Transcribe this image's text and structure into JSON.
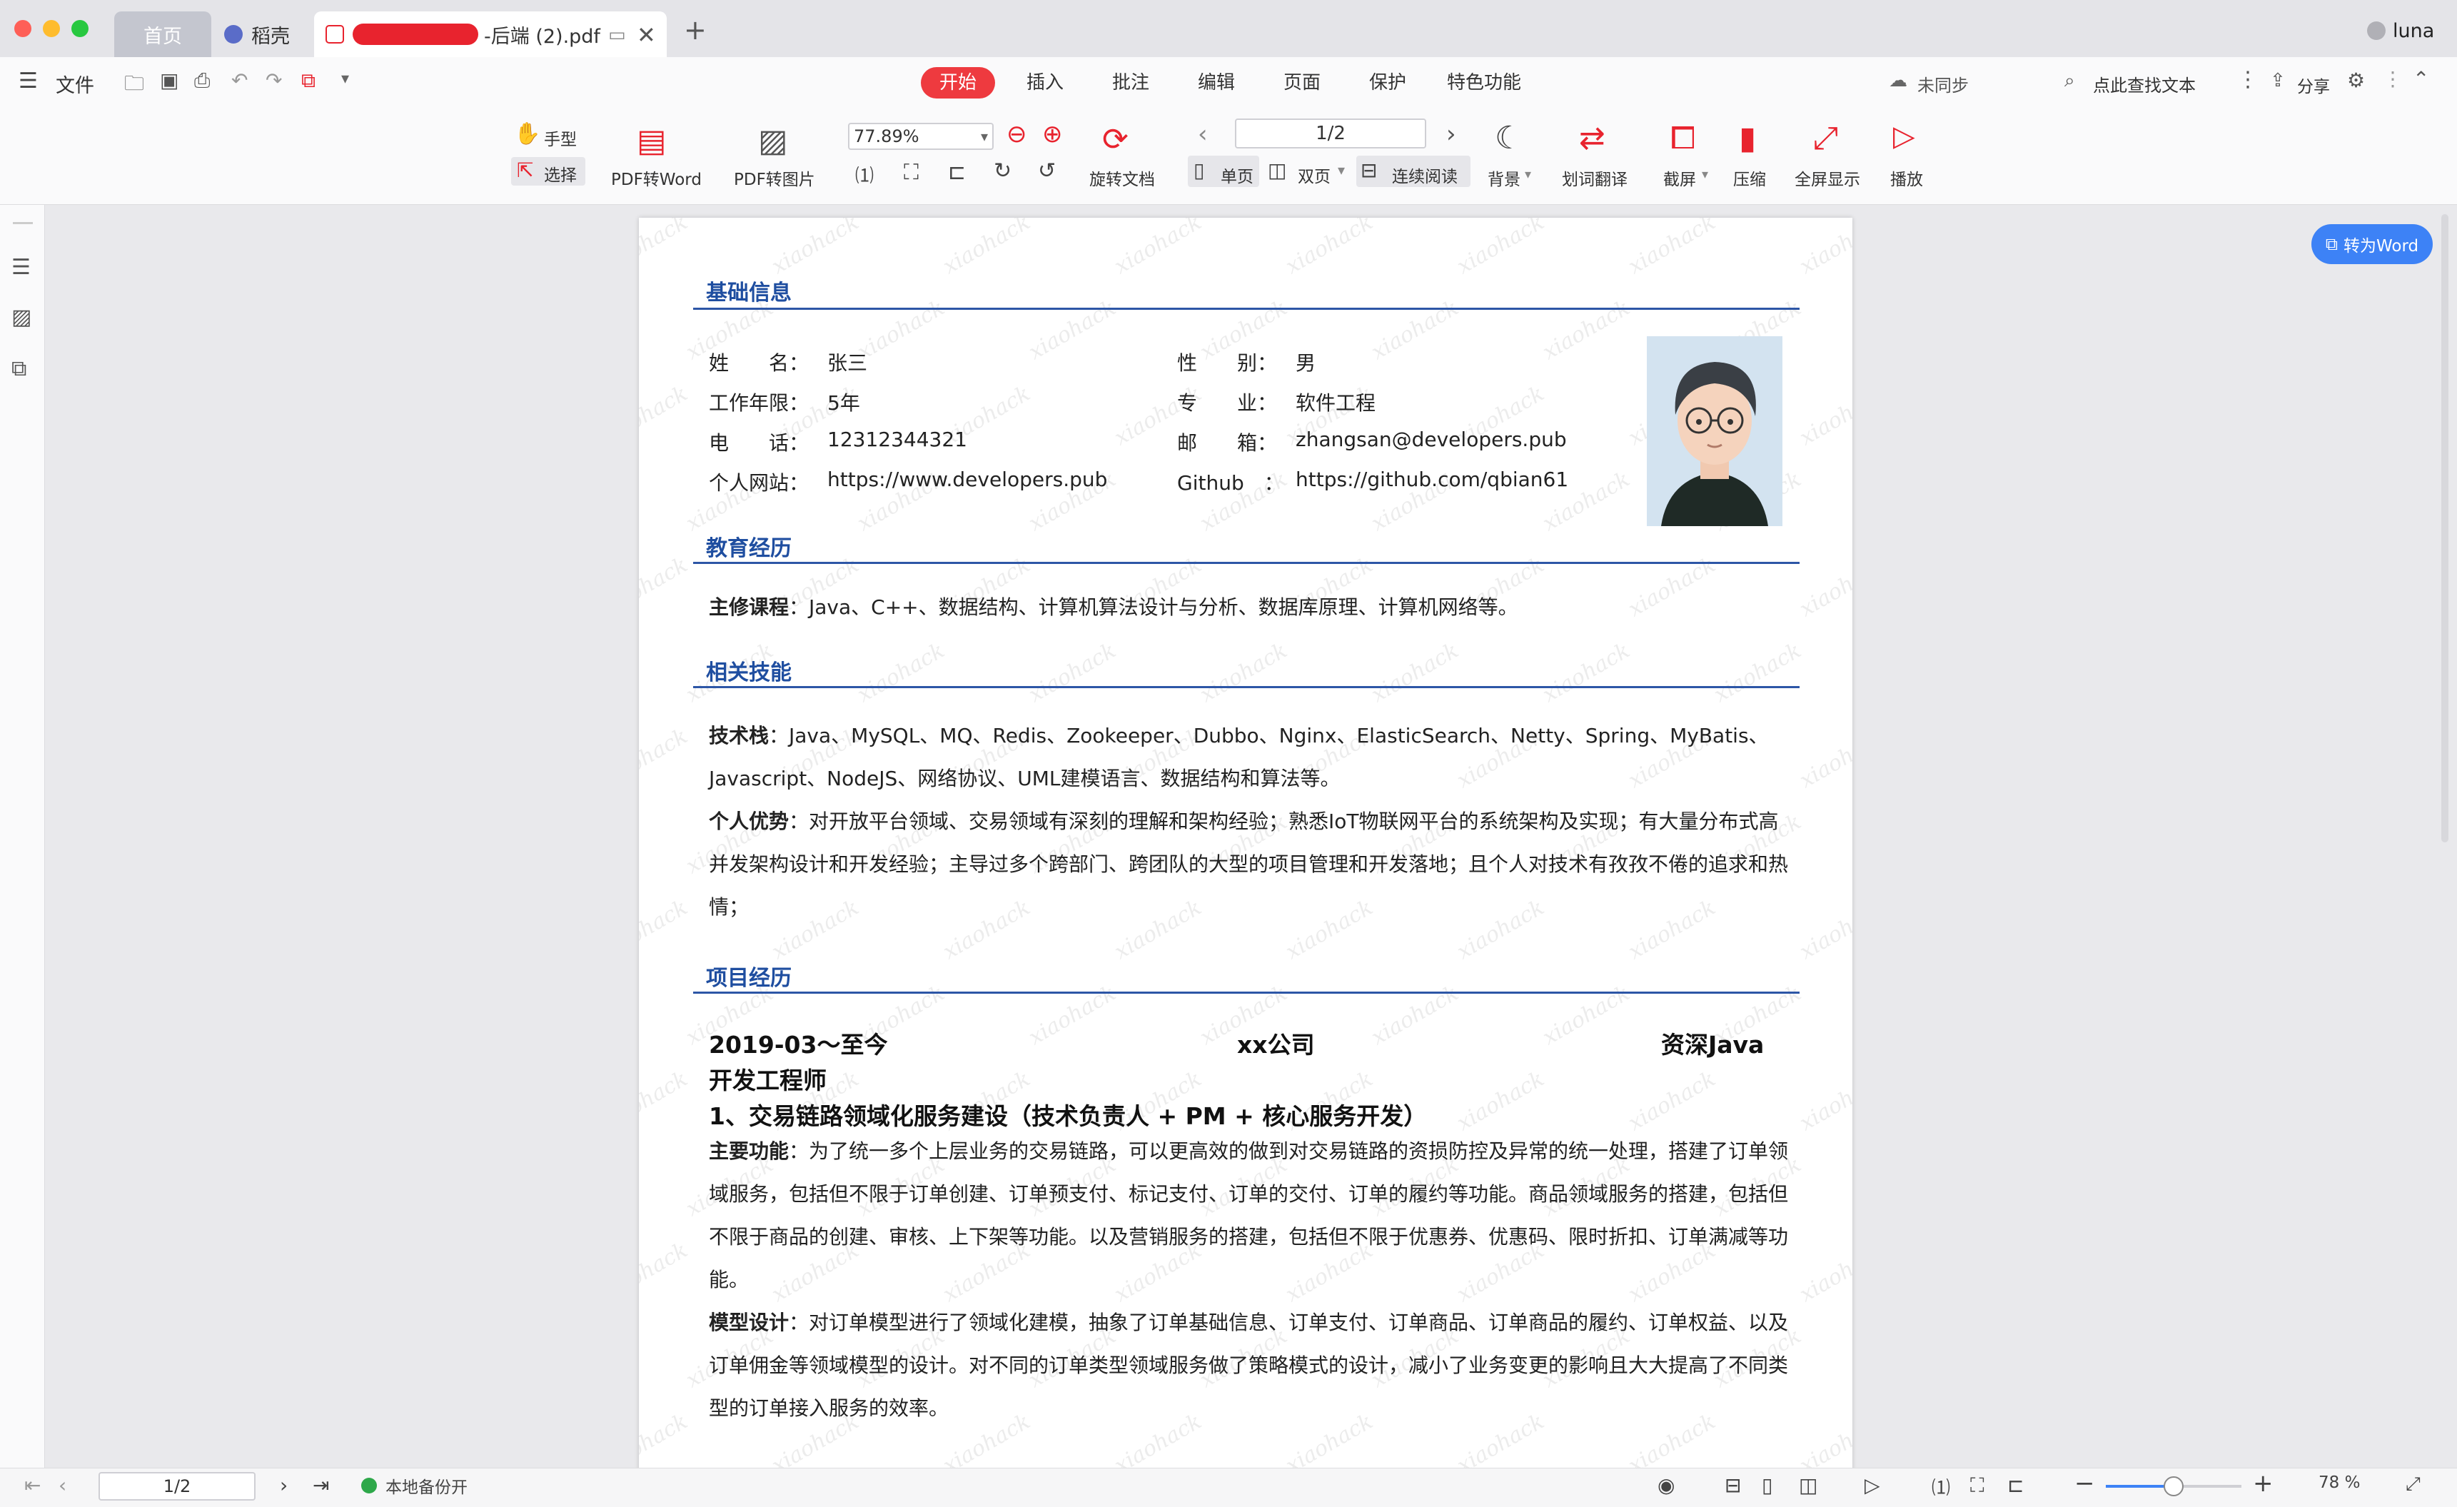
{
  "titlebar": {
    "tabs": [
      {
        "label": "首页"
      },
      {
        "label": "稻壳"
      },
      {
        "label": "-后端 (2).pdf"
      }
    ],
    "user": "luna"
  },
  "ribbon": {
    "file": "文件",
    "tabs": [
      "开始",
      "插入",
      "批注",
      "编辑",
      "页面",
      "保护",
      "特色功能"
    ],
    "sync": "未同步",
    "search": "点此查找文本",
    "share": "分享",
    "tools": {
      "hand": "手型",
      "select": "选择",
      "pdf_to_word": "PDF转Word",
      "pdf_to_image": "PDF转图片",
      "zoom": "77.89%",
      "page": "1/2",
      "rotate": "旋转文档",
      "single": "单页",
      "double": "双页",
      "continuous": "连续阅读",
      "background": "背景",
      "translate": "划词翻译",
      "screenshot": "截屏",
      "compress": "压缩",
      "fullscreen": "全屏显示",
      "play": "播放"
    },
    "convert_button": "转为Word"
  },
  "resume": {
    "watermark": "xiaohack",
    "sections": {
      "basic": "基础信息",
      "education": "教育经历",
      "skills": "相关技能",
      "projects": "项目经历"
    },
    "basic": {
      "name_label": "姓　　名：",
      "name": "张三",
      "years_label": "工作年限：",
      "years": "5年",
      "phone_label": "电　　话：",
      "phone": "12312344321",
      "site_label": "个人网站：",
      "site": "https://www.developers.pub",
      "gender_label": "性　　别：",
      "gender": "男",
      "major_label": "专　　业：",
      "major": "软件工程",
      "email_label": "邮　　箱：",
      "email": "zhangsan@developers.pub",
      "github_label": "Github　：",
      "github": "https://github.com/qbian61"
    },
    "education": {
      "label": "主修课程",
      "text": "：Java、C++、数据结构、计算机算法设计与分析、数据库原理、计算机网络等。"
    },
    "skills": {
      "stack_label": "技术栈",
      "stack": "：Java、MySQL、MQ、Redis、Zookeeper、Dubbo、Nginx、ElasticSearch、Netty、Spring、MyBatis、Javascript、NodeJS、网络协议、UML建模语言、数据结构和算法等。",
      "adv_label": "个人优势",
      "adv": "：对开放平台领域、交易领域有深刻的理解和架构经验；熟悉IoT物联网平台的系统架构及实现；有大量分布式高并发架构设计和开发经验；主导过多个跨部门、跨团队的大型的项目管理和开发落地；且个人对技术有孜孜不倦的追求和热情；"
    },
    "project": {
      "period": "2019-03～至今",
      "company": "xx公司",
      "role_a": "资深Java",
      "role_b": "开发工程师",
      "title": "1、交易链路领域化服务建设（技术负责人 + PM + 核心服务开发）",
      "func_label": "主要功能",
      "func": "：为了统一多个上层业务的交易链路，可以更高效的做到对交易链路的资损防控及异常的统一处理，搭建了订单领域服务，包括但不限于订单创建、订单预支付、标记支付、订单的交付、订单的履约等功能。商品领域服务的搭建，包括但不限于商品的创建、审核、上下架等功能。以及营销服务的搭建，包括但不限于优惠券、优惠码、限时折扣、订单满减等功能。",
      "model_label": "模型设计",
      "model": "：对订单模型进行了领域化建模，抽象了订单基础信息、订单支付、订单商品、订单商品的履约、订单权益、以及订单佣金等领域模型的设计。对不同的订单类型领域服务做了策略模式的设计，减小了业务变更的影响且大大提高了不同类型的订单接入服务的效率。"
    }
  },
  "statusbar": {
    "page": "1/2",
    "backup": "本地备份开",
    "zoom": "78 %",
    "zoom_level": 0.5
  }
}
